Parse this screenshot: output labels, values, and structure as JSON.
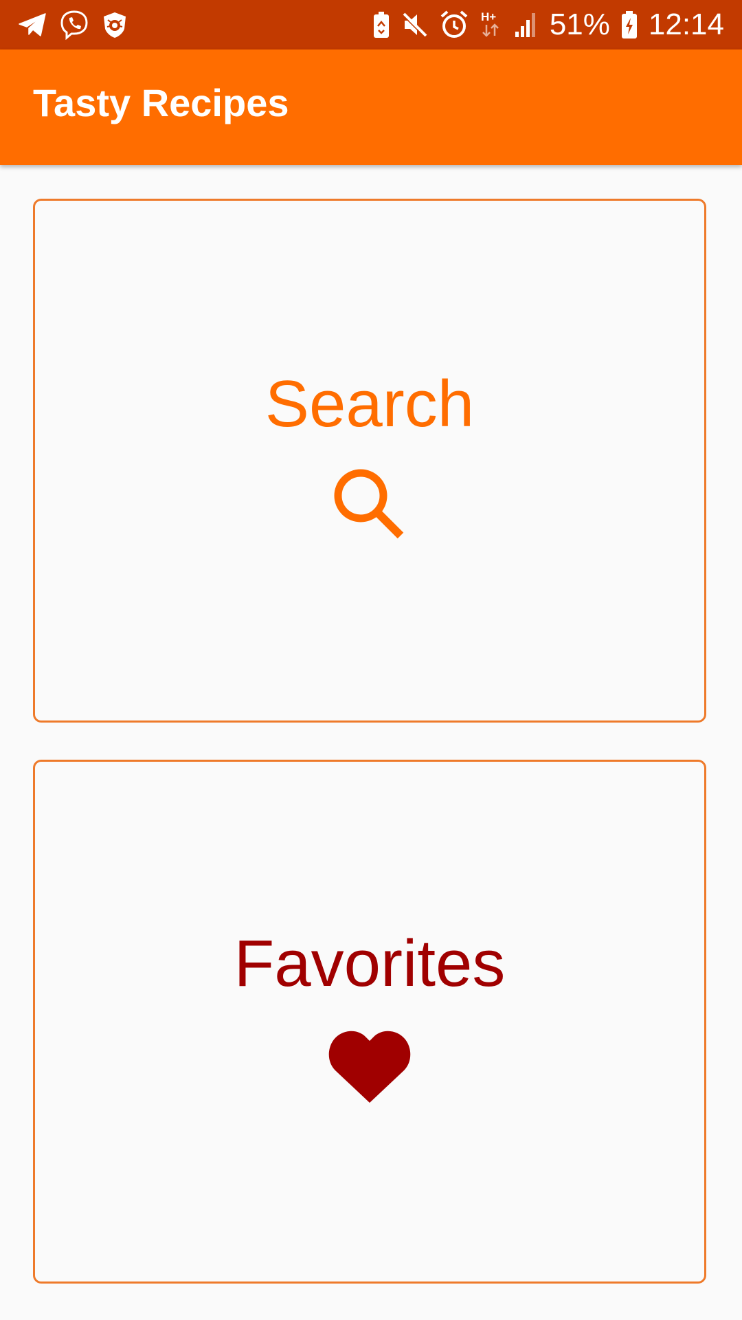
{
  "status_bar": {
    "left_icons": [
      "telegram-icon",
      "viber-icon",
      "dr-web-icon"
    ],
    "right_icons": [
      "battery-saver-icon",
      "mute-icon",
      "alarm-icon",
      "network-hplus-icon",
      "signal-icon",
      "battery-charging-icon"
    ],
    "network_label": "H+",
    "battery": "51%",
    "time": "12:14"
  },
  "app_bar": {
    "title": "Tasty Recipes"
  },
  "cards": {
    "search": {
      "label": "Search",
      "icon": "search-icon",
      "color": "#ff6d00"
    },
    "favorites": {
      "label": "Favorites",
      "icon": "heart-icon",
      "color": "#a00000"
    }
  },
  "colors": {
    "status_bar": "#c23a00",
    "app_bar": "#ff6d00",
    "card_border": "#ee7a2a",
    "background": "#fafafa"
  }
}
